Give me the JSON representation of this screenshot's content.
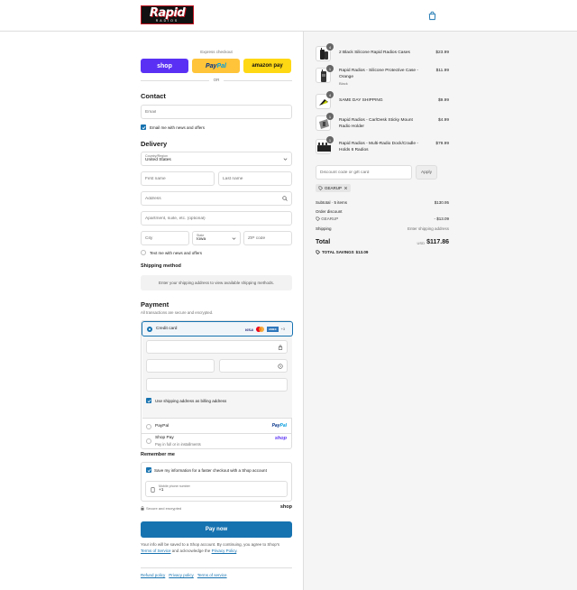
{
  "header": {
    "logo_word": "Rapid",
    "logo_sub": "RADIOS",
    "cart_icon": "shopping-bag-icon"
  },
  "express": {
    "label": "Express checkout",
    "shop": "shop",
    "paypal_a": "Pay",
    "paypal_b": "Pal",
    "amazon": "amazon pay",
    "or": "OR"
  },
  "contact": {
    "heading": "Contact",
    "email_placeholder": "Email",
    "news_label": "Email me with news and offers"
  },
  "delivery": {
    "heading": "Delivery",
    "country_label": "Country/Region",
    "country_value": "United States",
    "first_name": "First name",
    "last_name": "Last name",
    "address": "Address",
    "apartment": "Apartment, suite, etc. (optional)",
    "city": "City",
    "state_label": "State",
    "state_value": "Iowa",
    "zip": "ZIP code",
    "text_label": "Text me with news and offers"
  },
  "shipping": {
    "heading": "Shipping method",
    "message": "Enter your shipping address to view available shipping methods."
  },
  "payment": {
    "heading": "Payment",
    "subtitle": "All transactions are secure and encrypted.",
    "credit_card": "Credit card",
    "card_brands": [
      "VISA",
      "AMEX"
    ],
    "more_cards": "+3",
    "billing_label": "Use shipping address as billing address",
    "paypal_label": "PayPal",
    "shoppay_label": "Shop Pay",
    "shoppay_sub": "Pay in full or in installments",
    "shop_logo": "shop"
  },
  "remember": {
    "heading": "Remember me",
    "save_label": "Save my information for a faster checkout with a Shop account",
    "phone_label": "Mobile phone number",
    "phone_value": "+1",
    "secure_label": "Secure and encrypted",
    "shop_logo": "shop"
  },
  "pay_now": "Pay now",
  "legal": {
    "text_a": "Your info will be saved to a Shop account. By continuing, you agree to Shop's",
    "tos": "Terms of Service",
    "text_b": "and acknowledge the",
    "privacy": "Privacy Policy",
    "end": "."
  },
  "footer": {
    "refund": "Refund policy",
    "privacy": "Privacy policy",
    "terms": "Terms of service"
  },
  "cart": {
    "items": [
      {
        "qty": "4",
        "name": "2 Black Silicone Rapid Radios Cases",
        "sub": "",
        "price": "$23.99"
      },
      {
        "qty": "1",
        "name": "Rapid Radios - Silicone Protective Case - Orange",
        "sub": "Black",
        "price": "$11.99"
      },
      {
        "qty": "4",
        "name": "SAME DAY SHIPPING",
        "sub": "",
        "price": "$9.99"
      },
      {
        "qty": "1",
        "name": "Rapid Radios - Car/Desk Sticky Mount Radio Holder",
        "sub": "",
        "price": "$4.99"
      },
      {
        "qty": "1",
        "name": "Rapid Radios - Multi-Radio Dock/Cradle - Holds 6 Radios",
        "sub": "",
        "price": "$79.99"
      }
    ],
    "discount_placeholder": "Discount code or gift card",
    "apply": "Apply",
    "code": "GEARUP",
    "subtotal_label": "Subtotal · 5 items",
    "subtotal_value": "$130.95",
    "order_discount_label": "Order discount",
    "discount_code": "GEARUP",
    "discount_value": "- $13.09",
    "shipping_label": "Shipping",
    "shipping_value": "Enter shipping address",
    "total_label": "Total",
    "currency": "USD",
    "total_value": "$117.86",
    "savings_label": "TOTAL SAVINGS",
    "savings_value": "$13.09"
  },
  "colors": {
    "accent": "#1773b0",
    "shop": "#5a31f4",
    "paypal": "#ffc439",
    "amazon": "#ffd814"
  }
}
